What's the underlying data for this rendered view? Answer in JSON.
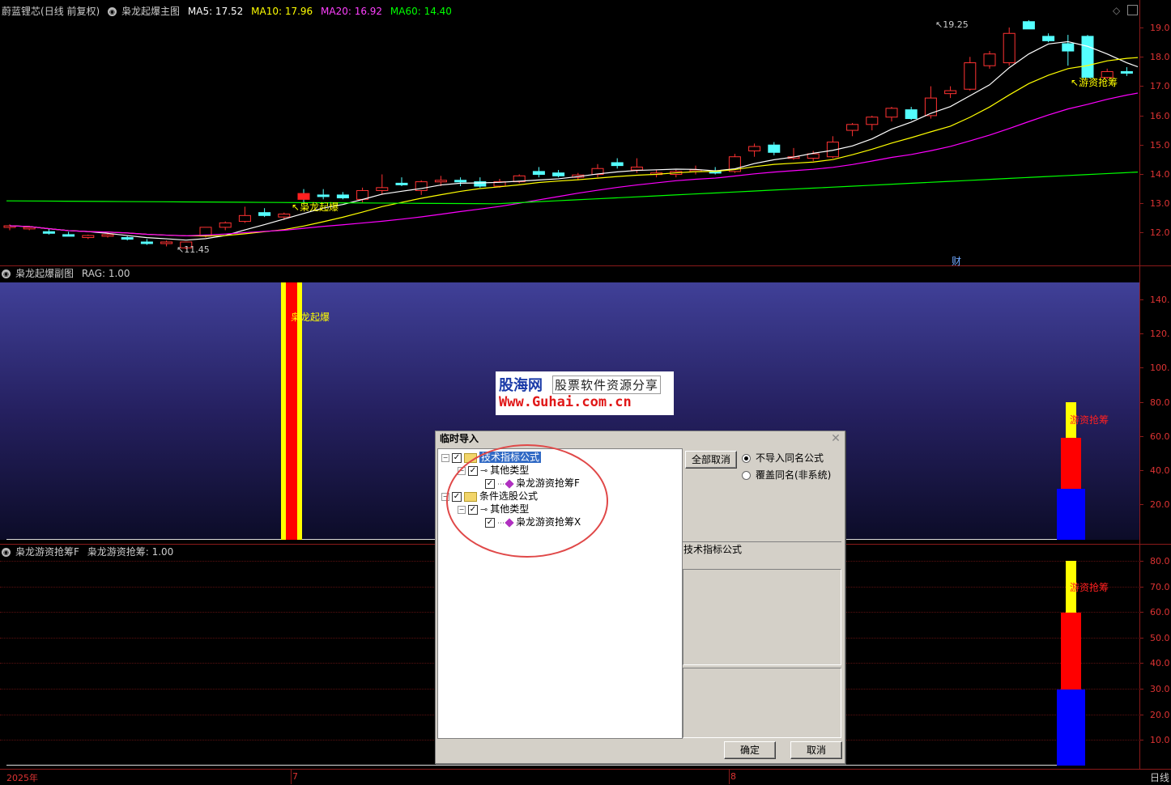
{
  "main_header": {
    "stock_name": "蔚蓝锂芯",
    "period": "(日线 前复权)",
    "indicator_name": "枭龙起爆主图",
    "ma5": "MA5: 17.52",
    "ma10": "MA10: 17.96",
    "ma20": "MA20: 16.92",
    "ma60": "MA60: 14.40"
  },
  "main_chart": {
    "y_axis_labels": [
      "19.0",
      "18.0",
      "17.0",
      "16.0",
      "15.0",
      "14.0",
      "13.0",
      "12.0"
    ],
    "high_marker": "19.25",
    "low_marker": "11.45",
    "signal_label": "枭龙起爆",
    "signal_label_right": "游资抢筹",
    "finance_mark": "财"
  },
  "sub1_header": {
    "name": "枭龙起爆副图",
    "value": "RAG: 1.00"
  },
  "sub1_chart": {
    "y_axis_labels": [
      "140.",
      "120.",
      "100.",
      "80.0",
      "60.0",
      "40.0",
      "20.0"
    ],
    "bar_label": "枭龙起爆",
    "right_label": "游资抢筹"
  },
  "sub2_header": {
    "name": "枭龙游资抢筹F",
    "value": "枭龙游资抢筹: 1.00"
  },
  "sub2_chart": {
    "y_axis_labels": [
      "80.0",
      "70.0",
      "60.0",
      "50.0",
      "40.0",
      "30.0",
      "20.0",
      "10.0"
    ],
    "right_label": "游资抢筹"
  },
  "time_axis": {
    "year": "2025年",
    "month_7": "7",
    "month_8": "8",
    "period_button": "日线"
  },
  "watermark": {
    "logo": "股海网",
    "slogan": "股票软件资源分享",
    "url": "Www.Guhai.com.cn"
  },
  "dialog": {
    "title": "临时导入",
    "tree": {
      "tech_folder": "技术指标公式",
      "tech_type": "其他类型",
      "tech_item": "枭龙游资抢筹F",
      "cond_folder": "条件选股公式",
      "cond_type": "其他类型",
      "cond_item": "枭龙游资抢筹X"
    },
    "cancel_all_button": "全部取消",
    "radio_no_import": "不导入同名公式",
    "radio_overwrite": "覆盖同名(非系统)",
    "info_label": "技术指标公式",
    "ok_button": "确定",
    "cancel_button": "取消"
  },
  "colors": {
    "ma5": "#ffffff",
    "ma10": "#ffff00",
    "ma20": "#ff00ff",
    "ma60": "#00ff00",
    "up_candle": "#ff3232",
    "down_candle": "#54ffff"
  }
}
